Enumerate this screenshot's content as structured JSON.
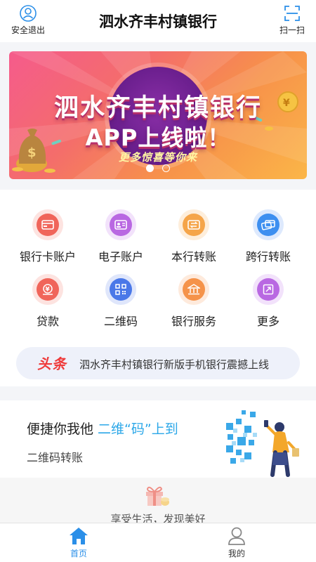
{
  "header": {
    "title": "泗水齐丰村镇银行",
    "left_button": {
      "label": "安全退出",
      "icon": "user-circle-icon"
    },
    "right_button": {
      "label": "扫一扫",
      "icon": "scan-icon"
    }
  },
  "banner": {
    "line1": "泗水齐丰村镇银行",
    "line2": "APP上线啦！",
    "line3": "更多惊喜等你来",
    "page_count": 2,
    "active_page": 1
  },
  "menu": [
    {
      "label": "银行卡账户",
      "icon": "bank-card-icon",
      "color": "#f0655a"
    },
    {
      "label": "电子账户",
      "icon": "id-card-icon",
      "color": "#b968e2"
    },
    {
      "label": "本行转账",
      "icon": "transfer-icon",
      "color": "#f5a54a"
    },
    {
      "label": "跨行转账",
      "icon": "cards-icon",
      "color": "#3d8ff0"
    },
    {
      "label": "贷款",
      "icon": "yuan-icon",
      "color": "#f0655a"
    },
    {
      "label": "二维码",
      "icon": "qr-code-icon",
      "color": "#4a78e8"
    },
    {
      "label": "银行服务",
      "icon": "bank-building-icon",
      "color": "#f5934a"
    },
    {
      "label": "更多",
      "icon": "more-icon",
      "color": "#b968e2"
    }
  ],
  "news": {
    "tag": "头条",
    "text": "泗水齐丰村镇银行新版手机银行震撼上线"
  },
  "promo": {
    "title_plain": "便捷你我他 ",
    "title_highlight": "二维“码”上到",
    "subtitle": "二维码转账"
  },
  "lower": {
    "slogan": "享受生活，发现美好"
  },
  "tabbar": [
    {
      "label": "首页",
      "icon": "home-icon",
      "active": true
    },
    {
      "label": "我的",
      "icon": "person-icon",
      "active": false
    }
  ],
  "colors": {
    "accent": "#2b8fe8",
    "highlight": "#2ba7e8",
    "news_tag": "#ef3a3a"
  }
}
